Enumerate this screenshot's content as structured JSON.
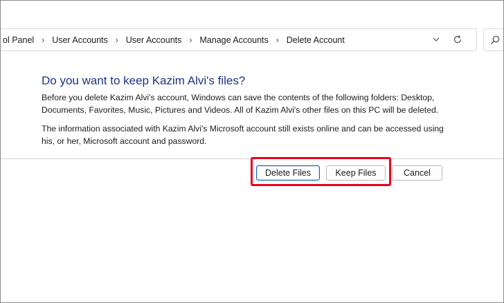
{
  "breadcrumb": {
    "items": [
      "ol Panel",
      "User Accounts",
      "User Accounts",
      "Manage Accounts",
      "Delete Account"
    ],
    "separator_icon": "chevron-right-icon"
  },
  "address_bar": {
    "dropdown_icon": "chevron-down-icon",
    "refresh_icon": "refresh-icon"
  },
  "search": {
    "icon": "search-icon"
  },
  "dialog": {
    "heading": "Do you want to keep Kazim Alvi's files?",
    "paragraph1": "Before you delete Kazim Alvi's account, Windows can save the contents of the following folders: Desktop, Documents, Favorites, Music, Pictures and Videos. All of Kazim Alvi's other files on this PC will be deleted.",
    "paragraph2": "The information associated with Kazim Alvi's Microsoft account still exists online and can be accessed using his, or her, Microsoft account and password.",
    "buttons": {
      "delete_files": "Delete Files",
      "keep_files": "Keep Files",
      "cancel": "Cancel"
    }
  },
  "colors": {
    "heading": "#1e3287",
    "highlight_box": "#e8001c",
    "default_button_border": "#0b5cbd"
  }
}
